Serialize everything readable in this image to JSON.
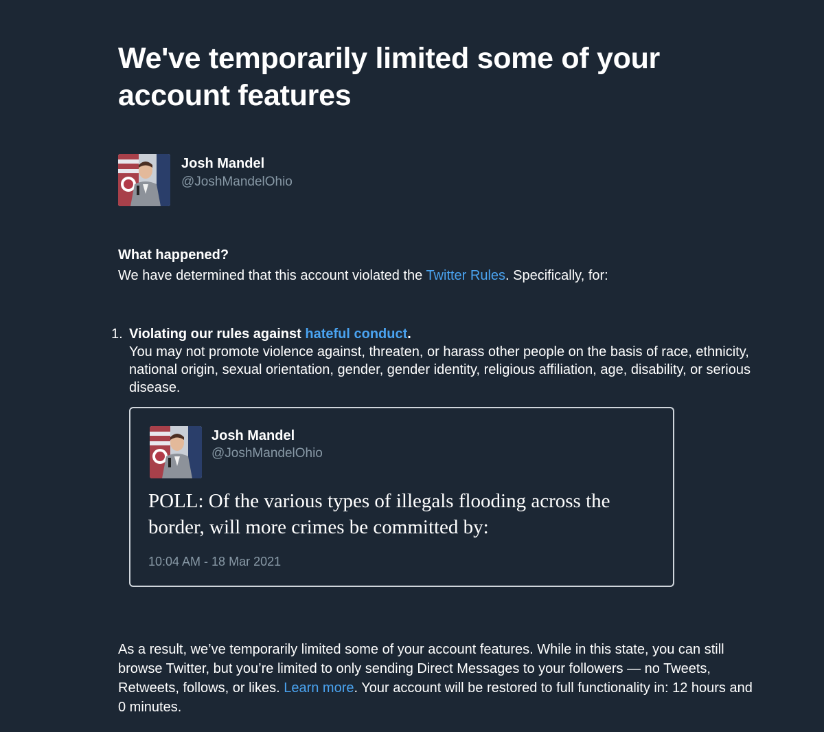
{
  "header": {
    "title": "We've temporarily limited some of your account features"
  },
  "account": {
    "name": "Josh Mandel",
    "handle": "@JoshMandelOhio"
  },
  "what_happened": {
    "heading": "What happened?",
    "text_before": "We have determined that this account violated the ",
    "rules_link": "Twitter Rules",
    "text_after": ". Specifically, for:"
  },
  "violation": {
    "number": "1.",
    "title_before": "Violating our rules against ",
    "title_link": "hateful conduct",
    "title_after": ".",
    "description": "You may not promote violence against, threaten, or harass other people on the basis of race, ethnicity, national origin, sexual orientation, gender, gender identity, religious affiliation, age, disability, or serious disease."
  },
  "tweet": {
    "name": "Josh Mandel",
    "handle": "@JoshMandelOhio",
    "text": "POLL: Of the various types of illegals flooding across the border, will more crimes be committed by:",
    "timestamp": "10:04 AM - 18 Mar 2021"
  },
  "result": {
    "text_before": "As a result, we’ve temporarily limited some of your account features. While in this state, you can still browse Twitter, but you’re limited to only sending Direct Messages to your followers — no Tweets, Retweets, follows, or likes. ",
    "learn_more_link": "Learn more",
    "text_after": ". Your account will be restored to full functionality in: 12 hours and 0 minutes."
  },
  "colors": {
    "background": "#1c2734",
    "link": "#4aa3f0",
    "muted": "#8899a6"
  }
}
